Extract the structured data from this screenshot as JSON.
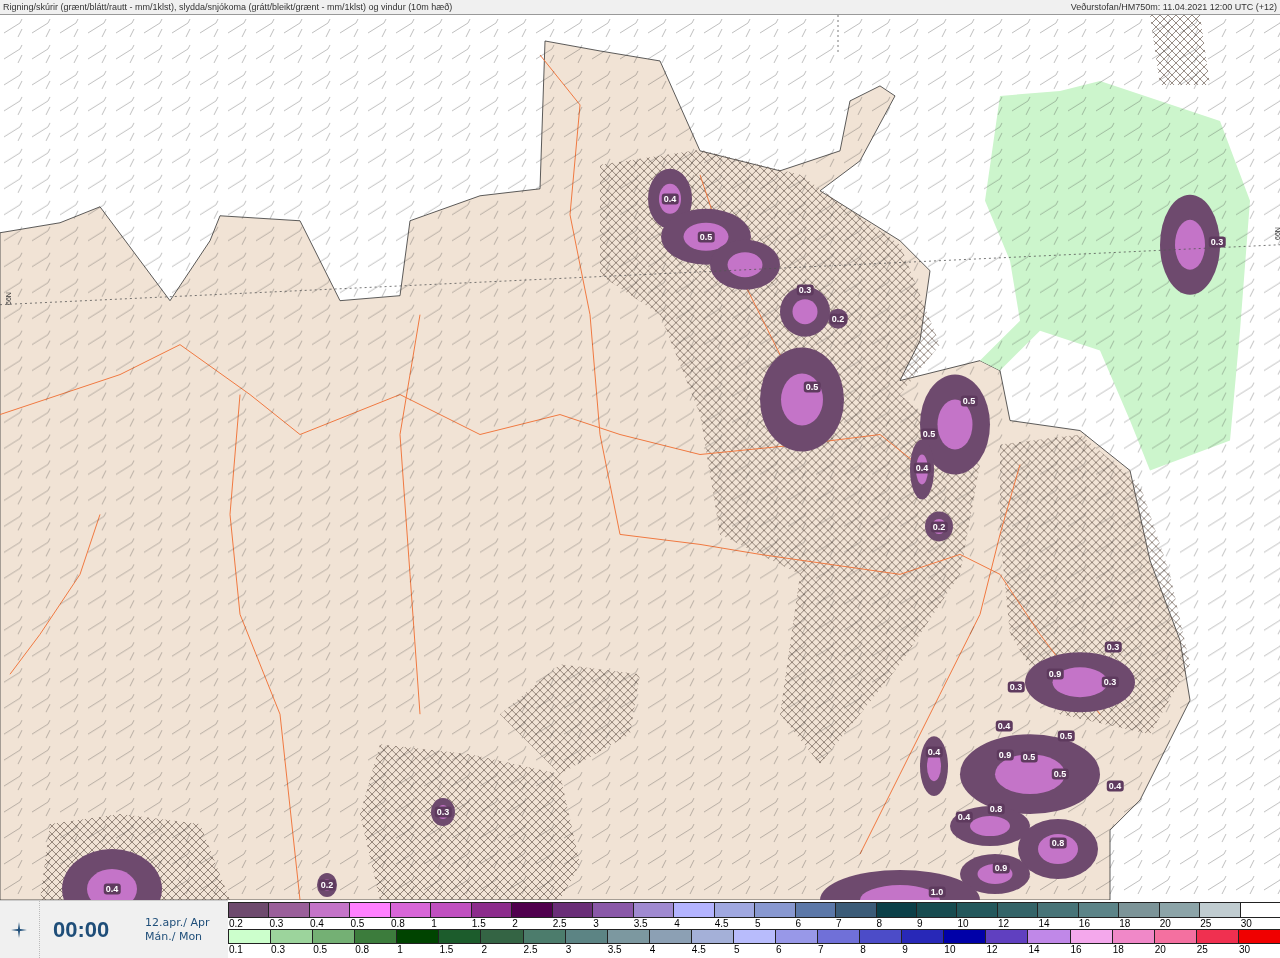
{
  "header": {
    "title": "Rigning/skúrir (grænt/blátt/rautt - mm/1klst), slydda/snjókoma (grátt/bleikt/grænt - mm/1klst) og vindur (10m hæð)",
    "source": "Veðurstofan/HM750m: 11.04.2021 12:00 UTC (+12)"
  },
  "map": {
    "latitude_labels": [
      "66N",
      "66N"
    ],
    "contour_labels": [
      "0.4",
      "0.5",
      "0.3",
      "0.2",
      "0.5",
      "0.3",
      "0.5",
      "0.5",
      "0.4",
      "0.2",
      "0.3",
      "0.9",
      "0.3",
      "0.3",
      "0.4",
      "0.5",
      "0.4",
      "0.9",
      "0.5",
      "0.5",
      "0.4",
      "0.8",
      "0.4",
      "0.8",
      "0.9",
      "1.0",
      "0.3",
      "0.2",
      "0.4"
    ]
  },
  "time_panel": {
    "time": "00:00",
    "date": "12.apr./ Apr",
    "weekday": "Mán./ Mon"
  },
  "legends": [
    {
      "kind": "snow",
      "items": [
        {
          "label": "0.2",
          "color": "#6e4a6e"
        },
        {
          "label": "0.3",
          "color": "#9a5f9a"
        },
        {
          "label": "0.4",
          "color": "#c474c8"
        },
        {
          "label": "0.5",
          "color": "#ff80ff"
        },
        {
          "label": "0.8",
          "color": "#d866d8"
        },
        {
          "label": "1",
          "color": "#c050c0"
        },
        {
          "label": "1.5",
          "color": "#8c2c8c"
        },
        {
          "label": "2",
          "color": "#50004e"
        },
        {
          "label": "2.5",
          "color": "#6a2e78"
        },
        {
          "label": "3",
          "color": "#8a58a8"
        },
        {
          "label": "3.5",
          "color": "#a08ad0"
        },
        {
          "label": "4",
          "color": "#b4b4ff"
        },
        {
          "label": "4.5",
          "color": "#a0a8e0"
        },
        {
          "label": "5",
          "color": "#8898d0"
        },
        {
          "label": "6",
          "color": "#5c78a8"
        },
        {
          "label": "7",
          "color": "#3c5c78"
        },
        {
          "label": "8",
          "color": "#0c4048"
        },
        {
          "label": "9",
          "color": "#184c50"
        },
        {
          "label": "10",
          "color": "#24585c"
        },
        {
          "label": "12",
          "color": "#346468"
        },
        {
          "label": "14",
          "color": "#487478"
        },
        {
          "label": "16",
          "color": "#5c8488"
        },
        {
          "label": "18",
          "color": "#7c9498"
        },
        {
          "label": "20",
          "color": "#8ca4a8"
        },
        {
          "label": "25",
          "color": "#c0ccd0"
        },
        {
          "label": "30",
          "color": "#ffffff"
        }
      ]
    },
    {
      "kind": "rain",
      "items": [
        {
          "label": "0.1",
          "color": "#ccffcc"
        },
        {
          "label": "0.3",
          "color": "#9cd49c"
        },
        {
          "label": "0.5",
          "color": "#74b074"
        },
        {
          "label": "0.8",
          "color": "#3c7c3c"
        },
        {
          "label": "1",
          "color": "#004400"
        },
        {
          "label": "1.5",
          "color": "#1c5c2c"
        },
        {
          "label": "2",
          "color": "#346444"
        },
        {
          "label": "2.5",
          "color": "#4c7c6c"
        },
        {
          "label": "3",
          "color": "#5c8484"
        },
        {
          "label": "3.5",
          "color": "#7c98a0"
        },
        {
          "label": "4",
          "color": "#8ca0b4"
        },
        {
          "label": "4.5",
          "color": "#a4b0d8"
        },
        {
          "label": "5",
          "color": "#b8bcfc"
        },
        {
          "label": "6",
          "color": "#9898e8"
        },
        {
          "label": "7",
          "color": "#7070d8"
        },
        {
          "label": "8",
          "color": "#4c4cc8"
        },
        {
          "label": "9",
          "color": "#2828b8"
        },
        {
          "label": "10",
          "color": "#0000a8"
        },
        {
          "label": "12",
          "color": "#6040c0"
        },
        {
          "label": "14",
          "color": "#c088e8"
        },
        {
          "label": "16",
          "color": "#f4a8ec"
        },
        {
          "label": "18",
          "color": "#f088c8"
        },
        {
          "label": "20",
          "color": "#f470a0"
        },
        {
          "label": "25",
          "color": "#f03050"
        },
        {
          "label": "30",
          "color": "#f00000"
        }
      ]
    }
  ]
}
